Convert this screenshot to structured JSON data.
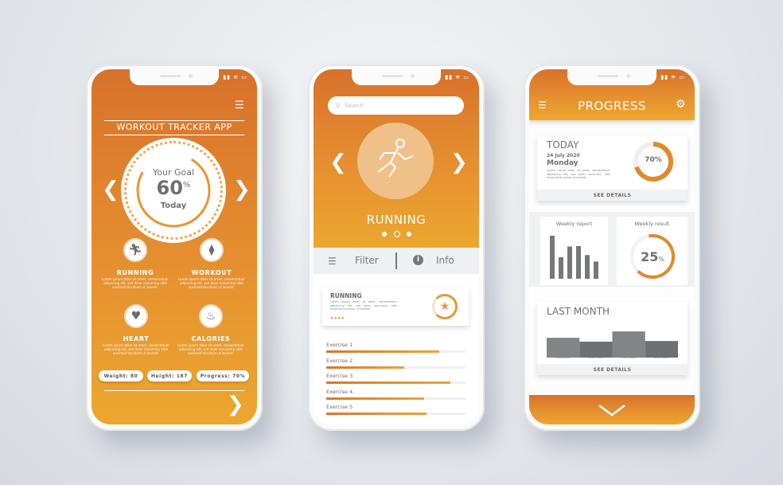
{
  "colors": {
    "orange_top": "#d8712a",
    "orange_bottom": "#eca72e",
    "bar_gray": "#7b7c80",
    "panel_gray": "#f0f1f3"
  },
  "status_icons": [
    "signal-icon",
    "wifi-icon",
    "battery-icon"
  ],
  "phone1": {
    "title": "WORKOUT TRACKER APP",
    "goal": {
      "label": "Your Goal",
      "value": "60",
      "unit": "%",
      "sub": "Today",
      "progress_percent": 60
    },
    "tiles": [
      {
        "label": "RUNNING",
        "icon": "running-icon",
        "text": "Lorem ipsum dolor sit amet, consectetuer adipiscing elit, sed diam nonummy nibh euismod tincidunt ut laoreet."
      },
      {
        "label": "WORKOUT",
        "icon": "dumbbell-icon",
        "text": "Lorem ipsum dolor sit amet, consectetuer adipiscing elit, sed diam nonummy nibh euismod tincidunt ut laoreet."
      },
      {
        "label": "HEART",
        "icon": "heart-icon",
        "text": "Lorem ipsum dolor sit amet, consectetuer adipiscing elit, sed diam nonummy nibh euismod tincidunt ut laoreet."
      },
      {
        "label": "CALORIES",
        "icon": "flame-icon",
        "text": "Lorem ipsum dolor sit amet, consectetuer adipiscing elit, sed diam nonummy nibh euismod tincidunt ut laoreet."
      }
    ],
    "stats": [
      "Weight: 80",
      "Height: 187",
      "Progress: 70%"
    ]
  },
  "phone2": {
    "search_placeholder": "Search",
    "activity": "RUNNING",
    "filter_label": "Filter",
    "info_label": "Info",
    "card": {
      "title": "RUNNING",
      "text": "Lorem ipsum dolor sit amet, consectetuer adipiscing elit, sed diam nonummy nibh euismod tincidunt ut laoreet.",
      "rating": 4
    },
    "exercises": [
      {
        "label": "Exercise 1",
        "progress": 81
      },
      {
        "label": "Exercise 2",
        "progress": 56
      },
      {
        "label": "Exercise 3",
        "progress": 89
      },
      {
        "label": "Exercise 4",
        "progress": 70
      },
      {
        "label": "Exercise 5",
        "progress": 72
      }
    ]
  },
  "phone3": {
    "title": "PROGRESS",
    "today": {
      "heading": "TODAY",
      "date": "24 July 2020",
      "day": "Monday",
      "text": "Lorem ipsum dolor sit amet, consectetuer adipiscing elit, sed diam nonummy nibh euismod tincidunt ut laoreet.",
      "percent_label": "70%",
      "percent": 70,
      "details": "SEE DETAILS"
    },
    "weekly_report": {
      "title": "Weekly report",
      "values": [
        100,
        50,
        75,
        76,
        55,
        40
      ]
    },
    "weekly_result": {
      "title": "Weekly result",
      "value": "25",
      "unit": "%",
      "percent": 25
    },
    "last_month": {
      "heading": "LAST MONTH",
      "values": [
        62,
        50,
        82,
        52
      ],
      "labels": [
        "Lorem ipsum",
        "Lorem ipsum",
        "Lorem ipsum",
        "Lorem ipsum"
      ],
      "details": "SEE DETAILS"
    }
  }
}
